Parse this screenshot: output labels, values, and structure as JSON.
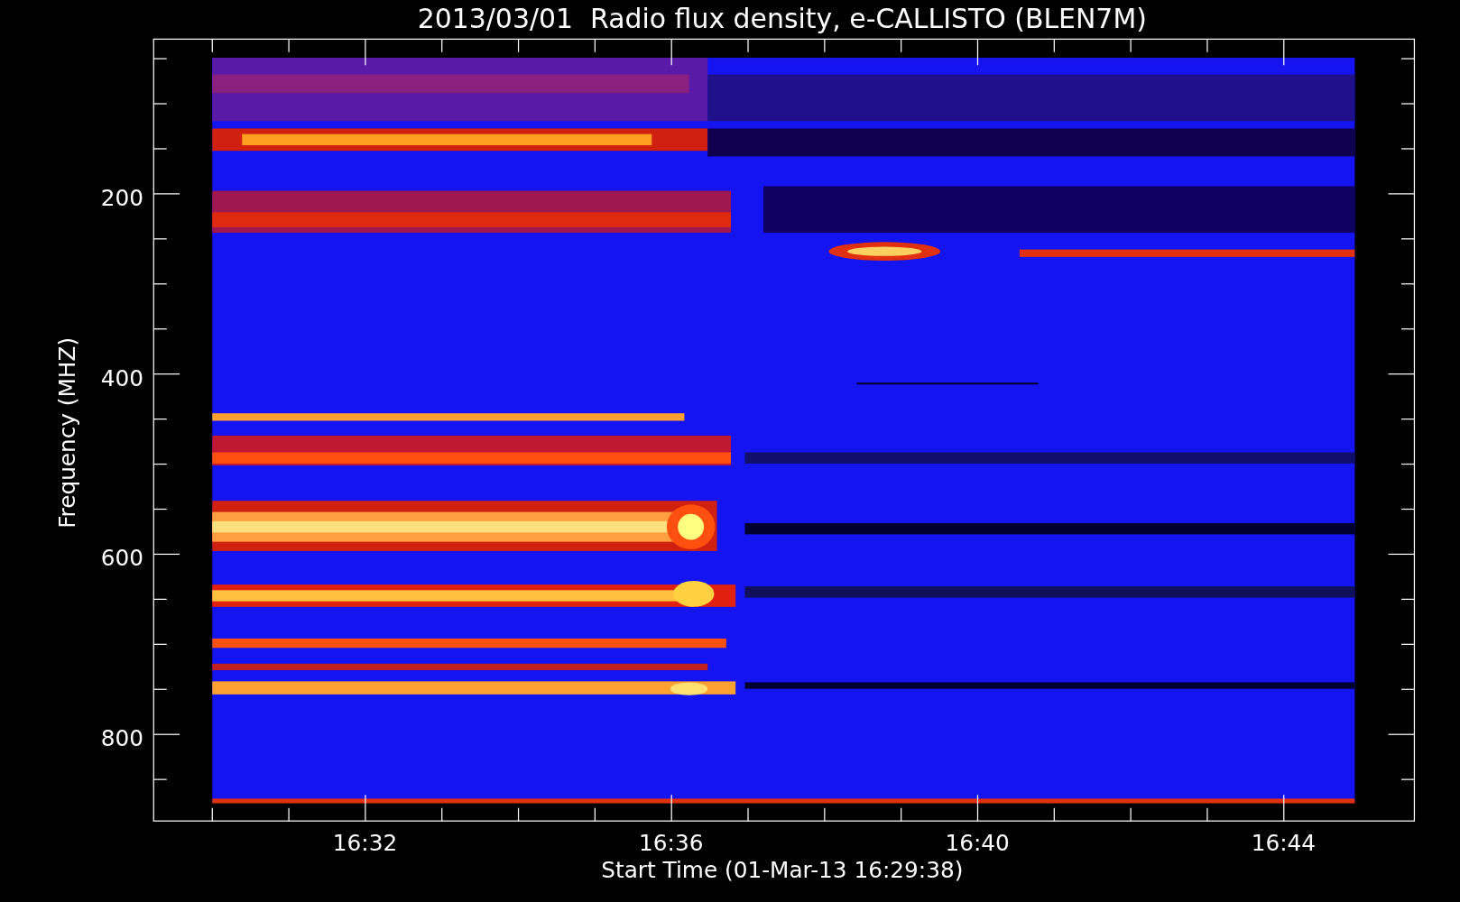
{
  "plot": {
    "title": "2013/03/01  Radio flux density, e-CALLISTO (BLEN7M)",
    "ylabel": "Frequency (MHZ)",
    "xlabel": "Start Time (01-Mar-13 16:29:38)",
    "y_ticks": [
      "200",
      "400",
      "600",
      "800"
    ],
    "x_ticks": [
      "16:32",
      "16:36",
      "16:40",
      "16:44"
    ]
  }
}
